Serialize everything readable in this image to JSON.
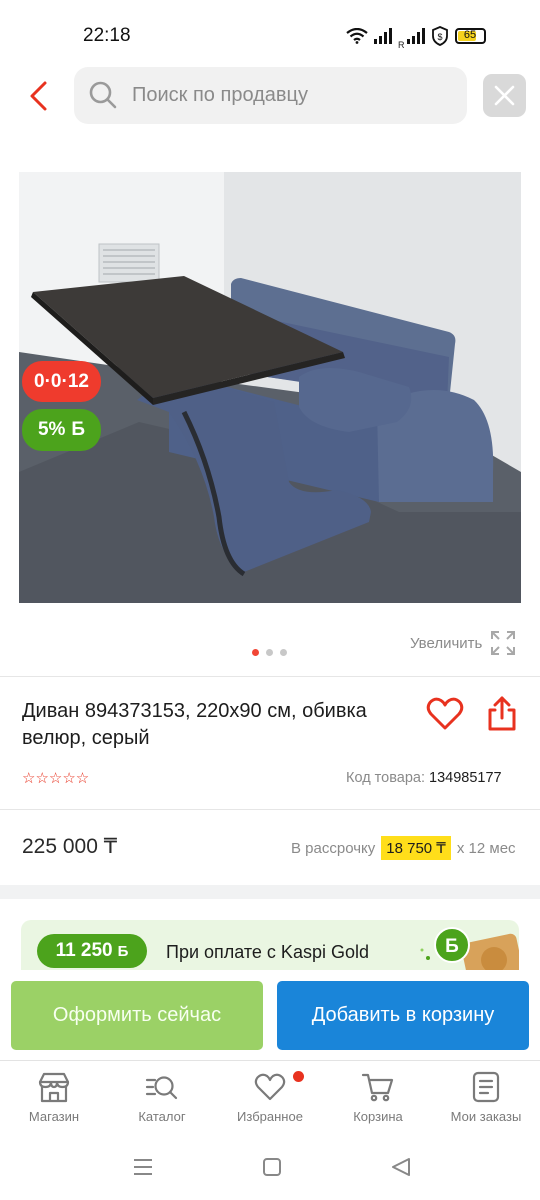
{
  "status_bar": {
    "time": "22:18",
    "battery": "65",
    "signal_label": "R",
    "icons": [
      "wifi-icon",
      "signal-icon",
      "signal-roaming-icon",
      "vpn-shield-icon",
      "battery-icon"
    ]
  },
  "header": {
    "search_placeholder": "Поиск по продавцу",
    "icons": [
      "back-icon",
      "search-icon",
      "close-icon"
    ]
  },
  "product": {
    "badges": {
      "installment": "0·0·12",
      "bonus_pct": "5%",
      "bonus_symbol": "Б"
    },
    "gallery": {
      "pages": 3,
      "current": 1
    },
    "zoom_label": "Увеличить",
    "title": "Диван 894373153, 220x90 см, обивка велюр, серый",
    "rating_stars": "☆☆☆☆☆",
    "sku_label": "Код товара:",
    "sku": "134985177",
    "price": "225 000 ₸",
    "installment_prefix": "В рассрочку",
    "installment_monthly": "18 750 ₸",
    "installment_suffix": "x 12 мес"
  },
  "promo": {
    "bonus_amount": "11 250",
    "bonus_symbol": "Б",
    "text": "При оплате с Kaspi Gold"
  },
  "actions": {
    "buy_now": "Оформить сейчас",
    "add_to_cart": "Добавить в корзину"
  },
  "tabs": [
    {
      "label": "Магазин",
      "icon": "shop-icon"
    },
    {
      "label": "Каталог",
      "icon": "catalog-icon"
    },
    {
      "label": "Избранное",
      "icon": "heart-icon"
    },
    {
      "label": "Корзина",
      "icon": "cart-icon"
    },
    {
      "label": "Мои заказы",
      "icon": "orders-icon"
    }
  ],
  "colors": {
    "accent_red": "#ef3b2d",
    "bonus_green": "#4ca31c",
    "primary_blue": "#1a85d9",
    "buy_green": "#9bd166",
    "installment_yellow": "#ffde1a"
  }
}
